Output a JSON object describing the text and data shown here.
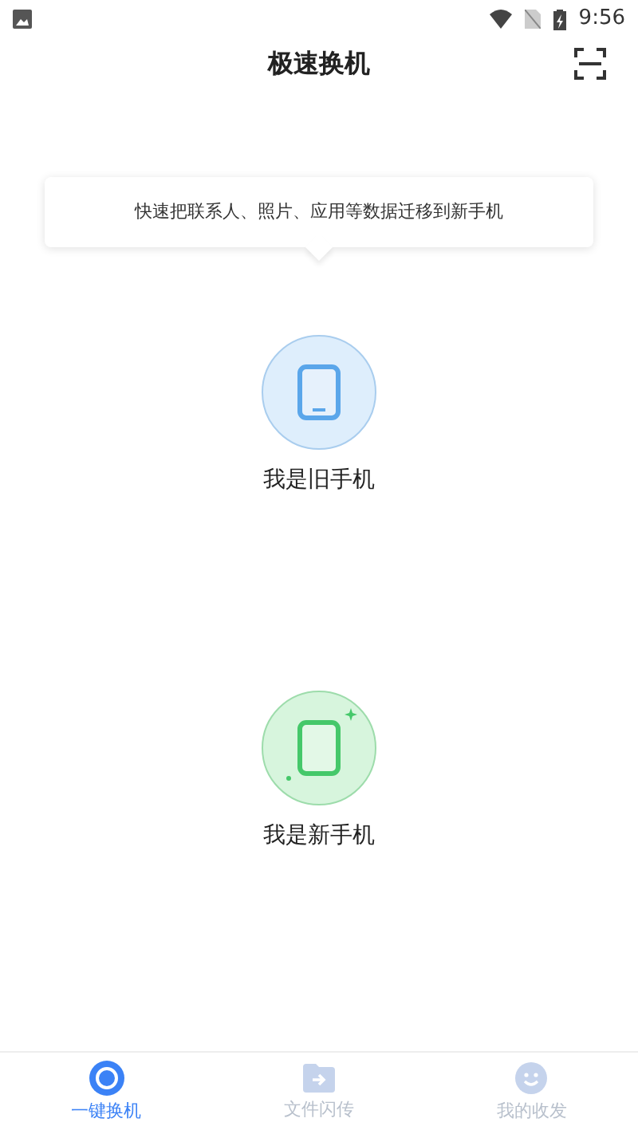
{
  "status_bar": {
    "time": "9:56"
  },
  "header": {
    "title": "极速换机"
  },
  "tip": {
    "text": "快速把联系人、照片、应用等数据迁移到新手机"
  },
  "options": [
    {
      "kind": "old",
      "label": "我是旧手机"
    },
    {
      "kind": "new",
      "label": "我是新手机"
    }
  ],
  "tabs": [
    {
      "kind": "switch",
      "label": "一键换机",
      "selected": true
    },
    {
      "kind": "files",
      "label": "文件闪传",
      "selected": false
    },
    {
      "kind": "mine",
      "label": "我的收发",
      "selected": false
    }
  ]
}
